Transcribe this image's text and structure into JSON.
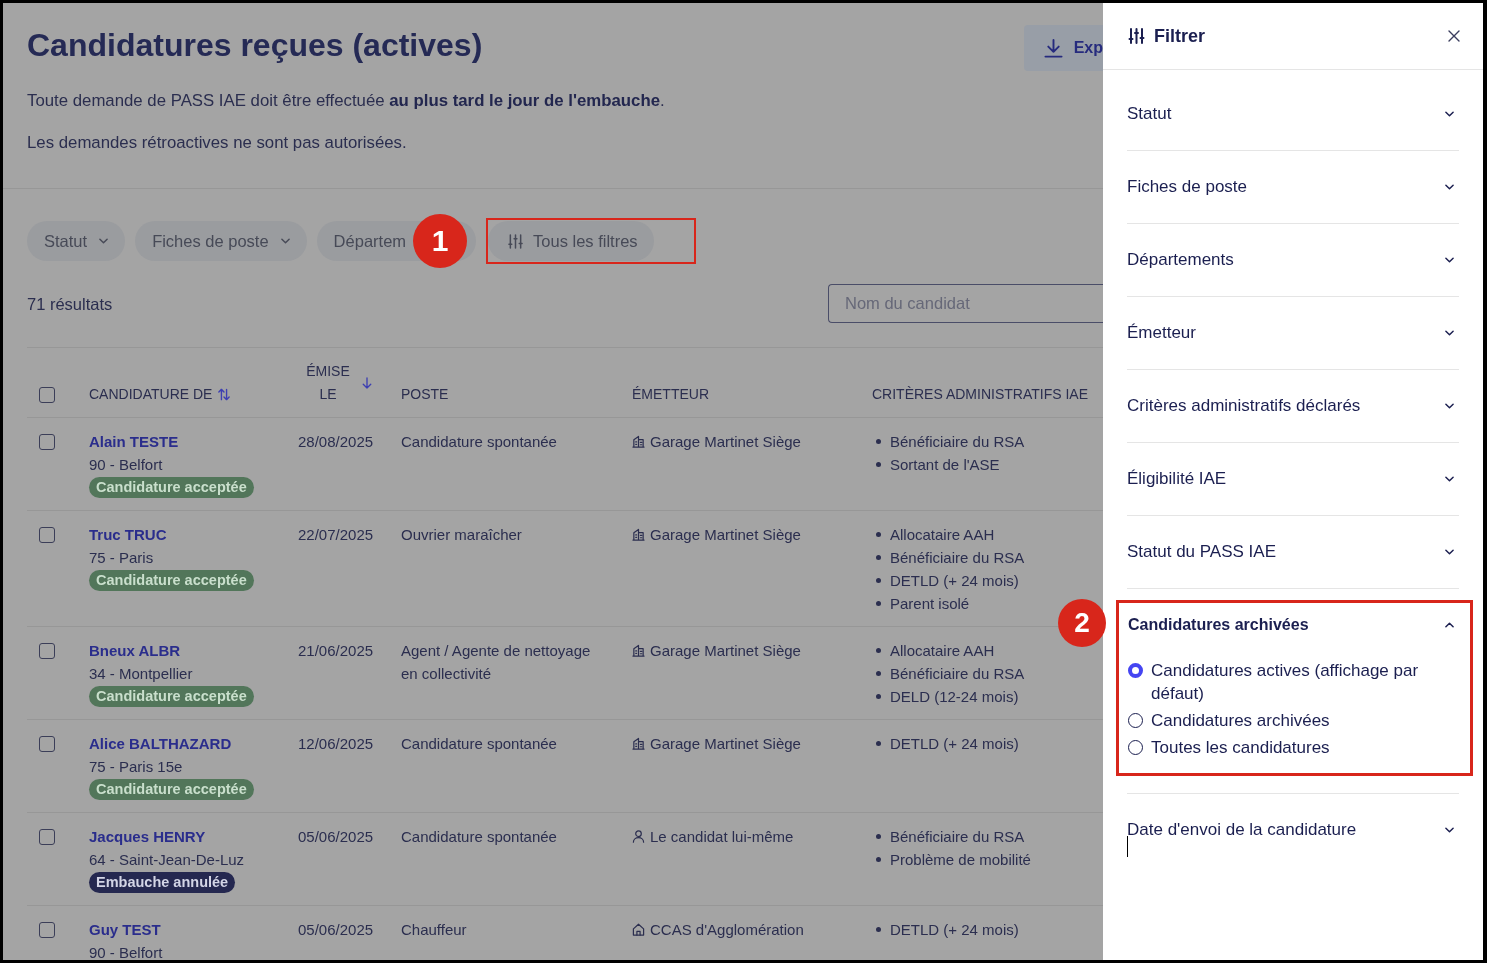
{
  "page": {
    "title": "Candidatures reçues (actives)",
    "export_button": "Exp",
    "notices": [
      "Toute demande de PASS IAE doit être effectuée **au plus tard le jour de l'embauche**.",
      "Les demandes rétroactives ne sont pas autorisées."
    ]
  },
  "filters": {
    "chips": [
      {
        "label": "Statut",
        "kind": "dropdown"
      },
      {
        "label": "Fiches de poste",
        "kind": "dropdown"
      },
      {
        "label": "Départem",
        "kind": "truncated"
      },
      {
        "label": "Tous les filtres",
        "kind": "filters",
        "callout": "1"
      }
    ],
    "results_count": "71 résultats",
    "search": {
      "placeholder": "Nom du candidat"
    }
  },
  "table": {
    "select_all": {
      "checked": false
    },
    "columns": [
      {
        "label": "CANDIDATURE DE",
        "sortable": true,
        "sorted": false
      },
      {
        "label": "ÉMISE LE",
        "sortable": true,
        "sorted": true
      },
      {
        "label": "POSTE",
        "sortable": false,
        "sorted": false
      },
      {
        "label": "ÉMETTEUR",
        "sortable": false,
        "sorted": false
      },
      {
        "label": "CRITÈRES ADMINISTRATIFS IAE",
        "sortable": false,
        "sorted": false
      }
    ],
    "rows": [
      {
        "checked": false,
        "name": "Alain TESTE",
        "location": "90 - Belfort",
        "status": {
          "label": "Candidature acceptée",
          "kind": "accepted"
        },
        "date": "28/08/2025",
        "job": "Candidature spontanée",
        "sender": {
          "label": "Garage Martinet Siège",
          "kind": "company"
        },
        "criteria": [
          "Bénéficiaire du RSA",
          "Sortant de l'ASE"
        ]
      },
      {
        "checked": false,
        "name": "Truc TRUC",
        "location": "75 - Paris",
        "status": {
          "label": "Candidature acceptée",
          "kind": "accepted"
        },
        "date": "22/07/2025",
        "job": "Ouvrier maraîcher",
        "sender": {
          "label": "Garage Martinet Siège",
          "kind": "company"
        },
        "criteria": [
          "Allocataire AAH",
          "Bénéficiaire du RSA",
          "DETLD (+ 24 mois)",
          "Parent isolé"
        ]
      },
      {
        "checked": false,
        "name": "Bneux ALBR",
        "location": "34 - Montpellier",
        "status": {
          "label": "Candidature acceptée",
          "kind": "accepted"
        },
        "date": "21/06/2025",
        "job": "Agent / Agente de nettoyage en collectivité",
        "sender": {
          "label": "Garage Martinet Siège",
          "kind": "company"
        },
        "criteria": [
          "Allocataire AAH",
          "Bénéficiaire du RSA",
          "DELD (12-24 mois)"
        ]
      },
      {
        "checked": false,
        "name": "Alice BALTHAZARD",
        "location": "75 - Paris 15e",
        "status": {
          "label": "Candidature acceptée",
          "kind": "accepted"
        },
        "date": "12/06/2025",
        "job": "Candidature spontanée",
        "sender": {
          "label": "Garage Martinet Siège",
          "kind": "company"
        },
        "criteria": [
          "DETLD (+ 24 mois)"
        ]
      },
      {
        "checked": false,
        "name": "Jacques HENRY",
        "location": "64 - Saint-Jean-De-Luz",
        "status": {
          "label": "Embauche annulée",
          "kind": "cancelled"
        },
        "date": "05/06/2025",
        "job": "Candidature spontanée",
        "sender": {
          "label": "Le candidat lui-même",
          "kind": "candidate"
        },
        "criteria": [
          "Bénéficiaire du RSA",
          "Problème de mobilité"
        ]
      },
      {
        "checked": false,
        "name": "Guy TEST",
        "location": "90 - Belfort",
        "date": "05/06/2025",
        "job": "Chauffeur",
        "sender": {
          "label": "CCAS d'Agglomération",
          "kind": "agency"
        },
        "criteria": [
          "DETLD (+ 24 mois)"
        ]
      }
    ]
  },
  "drawer": {
    "title": "Filtrer",
    "sections": [
      {
        "label": "Statut",
        "expanded": false,
        "focused": false
      },
      {
        "label": "Fiches de poste",
        "expanded": false,
        "focused": false
      },
      {
        "label": "Départements",
        "expanded": false,
        "focused": false
      },
      {
        "label": "Émetteur",
        "expanded": false,
        "focused": false
      },
      {
        "label": "Critères administratifs déclarés",
        "expanded": false,
        "focused": false
      },
      {
        "label": "Éligibilité IAE",
        "expanded": false,
        "focused": false
      },
      {
        "label": "Statut du PASS IAE",
        "expanded": false,
        "focused": false
      },
      {
        "label": "Candidatures archivées",
        "expanded": true,
        "focused": false,
        "callout": "2",
        "options": [
          {
            "label": "Candidatures actives (affichage par défaut)",
            "selected": true
          },
          {
            "label": "Candidatures archivées",
            "selected": false
          },
          {
            "label": "Toutes les candidatures",
            "selected": false
          }
        ]
      },
      {
        "label": "Date d'envoi de la candidature",
        "expanded": false,
        "focused": true
      }
    ]
  }
}
